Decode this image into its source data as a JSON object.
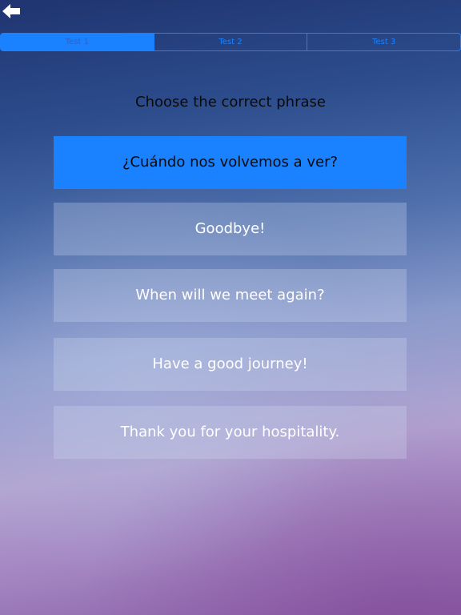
{
  "nav": {
    "back_icon": "arrow-left-icon"
  },
  "tabs": [
    {
      "label": "Test 1",
      "selected": true
    },
    {
      "label": "Test 2",
      "selected": false
    },
    {
      "label": "Test 3",
      "selected": false
    }
  ],
  "quiz": {
    "prompt": "Choose the correct phrase",
    "phrase": "¿Cuándo nos volvemos a ver?",
    "options": [
      "Goodbye!",
      "When will we meet again?",
      "Have a good journey!",
      "Thank you for your hospitality."
    ]
  },
  "colors": {
    "accent": "#1a82ff",
    "text_dark": "#0a0a0a",
    "text_light": "#ffffff"
  }
}
